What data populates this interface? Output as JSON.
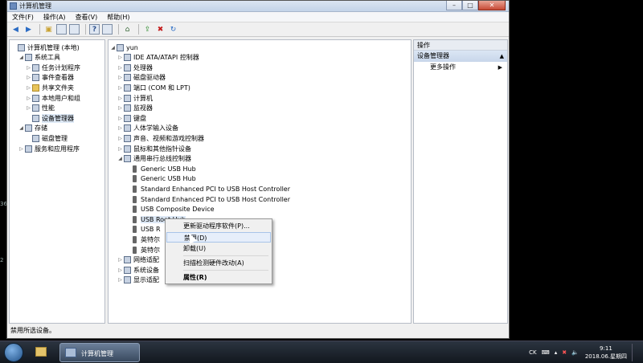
{
  "window": {
    "title": "计算机管理",
    "controls": [
      "–",
      "□",
      "✕"
    ]
  },
  "menubar": [
    "文件(F)",
    "操作(A)",
    "查看(V)",
    "帮助(H)"
  ],
  "left_tree": [
    {
      "label": "计算机管理 (本地)",
      "indent": 0,
      "arrow": "",
      "icon": "computer-management-icon"
    },
    {
      "label": "系统工具",
      "indent": 1,
      "arrow": "◢",
      "icon": "system-tools-icon"
    },
    {
      "label": "任务计划程序",
      "indent": 2,
      "arrow": "▷",
      "icon": "task-scheduler-icon"
    },
    {
      "label": "事件查看器",
      "indent": 2,
      "arrow": "▷",
      "icon": "event-viewer-icon"
    },
    {
      "label": "共享文件夹",
      "indent": 2,
      "arrow": "▷",
      "icon": "shared-folder-icon"
    },
    {
      "label": "本地用户和组",
      "indent": 2,
      "arrow": "▷",
      "icon": "users-icon"
    },
    {
      "label": "性能",
      "indent": 2,
      "arrow": "▷",
      "icon": "performance-icon"
    },
    {
      "label": "设备管理器",
      "indent": 2,
      "arrow": "",
      "icon": "device-manager-icon",
      "selected": true
    },
    {
      "label": "存储",
      "indent": 1,
      "arrow": "◢",
      "icon": "storage-icon"
    },
    {
      "label": "磁盘管理",
      "indent": 2,
      "arrow": "",
      "icon": "disk-management-icon"
    },
    {
      "label": "服务和应用程序",
      "indent": 1,
      "arrow": "▷",
      "icon": "services-icon"
    }
  ],
  "device_tree": [
    {
      "label": "yun",
      "indent": 0,
      "arrow": "◢",
      "icon": "computer-icon"
    },
    {
      "label": "IDE ATA/ATAPI 控制器",
      "indent": 1,
      "arrow": "▷",
      "icon": "ide-icon"
    },
    {
      "label": "处理器",
      "indent": 1,
      "arrow": "▷",
      "icon": "processor-icon"
    },
    {
      "label": "磁盘驱动器",
      "indent": 1,
      "arrow": "▷",
      "icon": "disk-drive-icon"
    },
    {
      "label": "端口 (COM 和 LPT)",
      "indent": 1,
      "arrow": "▷",
      "icon": "port-icon"
    },
    {
      "label": "计算机",
      "indent": 1,
      "arrow": "▷",
      "icon": "computer-icon"
    },
    {
      "label": "监视器",
      "indent": 1,
      "arrow": "▷",
      "icon": "monitor-icon"
    },
    {
      "label": "键盘",
      "indent": 1,
      "arrow": "▷",
      "icon": "keyboard-icon"
    },
    {
      "label": "人体学输入设备",
      "indent": 1,
      "arrow": "▷",
      "icon": "hid-icon"
    },
    {
      "label": "声音、视频和游戏控制器",
      "indent": 1,
      "arrow": "▷",
      "icon": "sound-icon"
    },
    {
      "label": "鼠标和其他指针设备",
      "indent": 1,
      "arrow": "▷",
      "icon": "mouse-icon"
    },
    {
      "label": "通用串行总线控制器",
      "indent": 1,
      "arrow": "◢",
      "icon": "usb-icon"
    },
    {
      "label": "Generic USB Hub",
      "indent": 2,
      "arrow": "",
      "icon": "usb-device-icon"
    },
    {
      "label": "Generic USB Hub",
      "indent": 2,
      "arrow": "",
      "icon": "usb-device-icon"
    },
    {
      "label": "Standard Enhanced PCI to USB Host Controller",
      "indent": 2,
      "arrow": "",
      "icon": "usb-device-icon"
    },
    {
      "label": "Standard Enhanced PCI to USB Host Controller",
      "indent": 2,
      "arrow": "",
      "icon": "usb-device-icon"
    },
    {
      "label": "USB Composite Device",
      "indent": 2,
      "arrow": "",
      "icon": "usb-device-icon"
    },
    {
      "label": "USB Root Hub",
      "indent": 2,
      "arrow": "",
      "icon": "usb-device-icon",
      "selected": true
    },
    {
      "label": "USB R",
      "indent": 2,
      "arrow": "",
      "icon": "usb-device-icon"
    },
    {
      "label": "英特尔",
      "indent": 2,
      "arrow": "",
      "icon": "usb-device-icon"
    },
    {
      "label": "英特尔",
      "indent": 2,
      "arrow": "",
      "icon": "usb-device-icon"
    },
    {
      "label": "网络适配",
      "indent": 1,
      "arrow": "▷",
      "icon": "network-icon"
    },
    {
      "label": "系统设备",
      "indent": 1,
      "arrow": "▷",
      "icon": "system-device-icon"
    },
    {
      "label": "显示适配",
      "indent": 1,
      "arrow": "▷",
      "icon": "display-icon"
    }
  ],
  "actions_pane": {
    "header": "操作",
    "section": "设备管理器",
    "more": "更多操作"
  },
  "context_menu": {
    "update": "更新驱动程序软件(P)...",
    "disable": "禁用(D)",
    "uninstall": "卸载(U)",
    "scan": "扫描检测硬件改动(A)",
    "properties": "属性(R)"
  },
  "status_text": "禁用所选设备。",
  "taskbar": {
    "active_app": "计算机管理",
    "lang": "CK",
    "time": "9:11",
    "date": "2018.06.星期四"
  },
  "edge_labels": [
    "36",
    "2"
  ],
  "colors": {
    "selection": "#dde8f5",
    "menu_highlight": "#e6eefa",
    "taskbar": "#12171e"
  }
}
